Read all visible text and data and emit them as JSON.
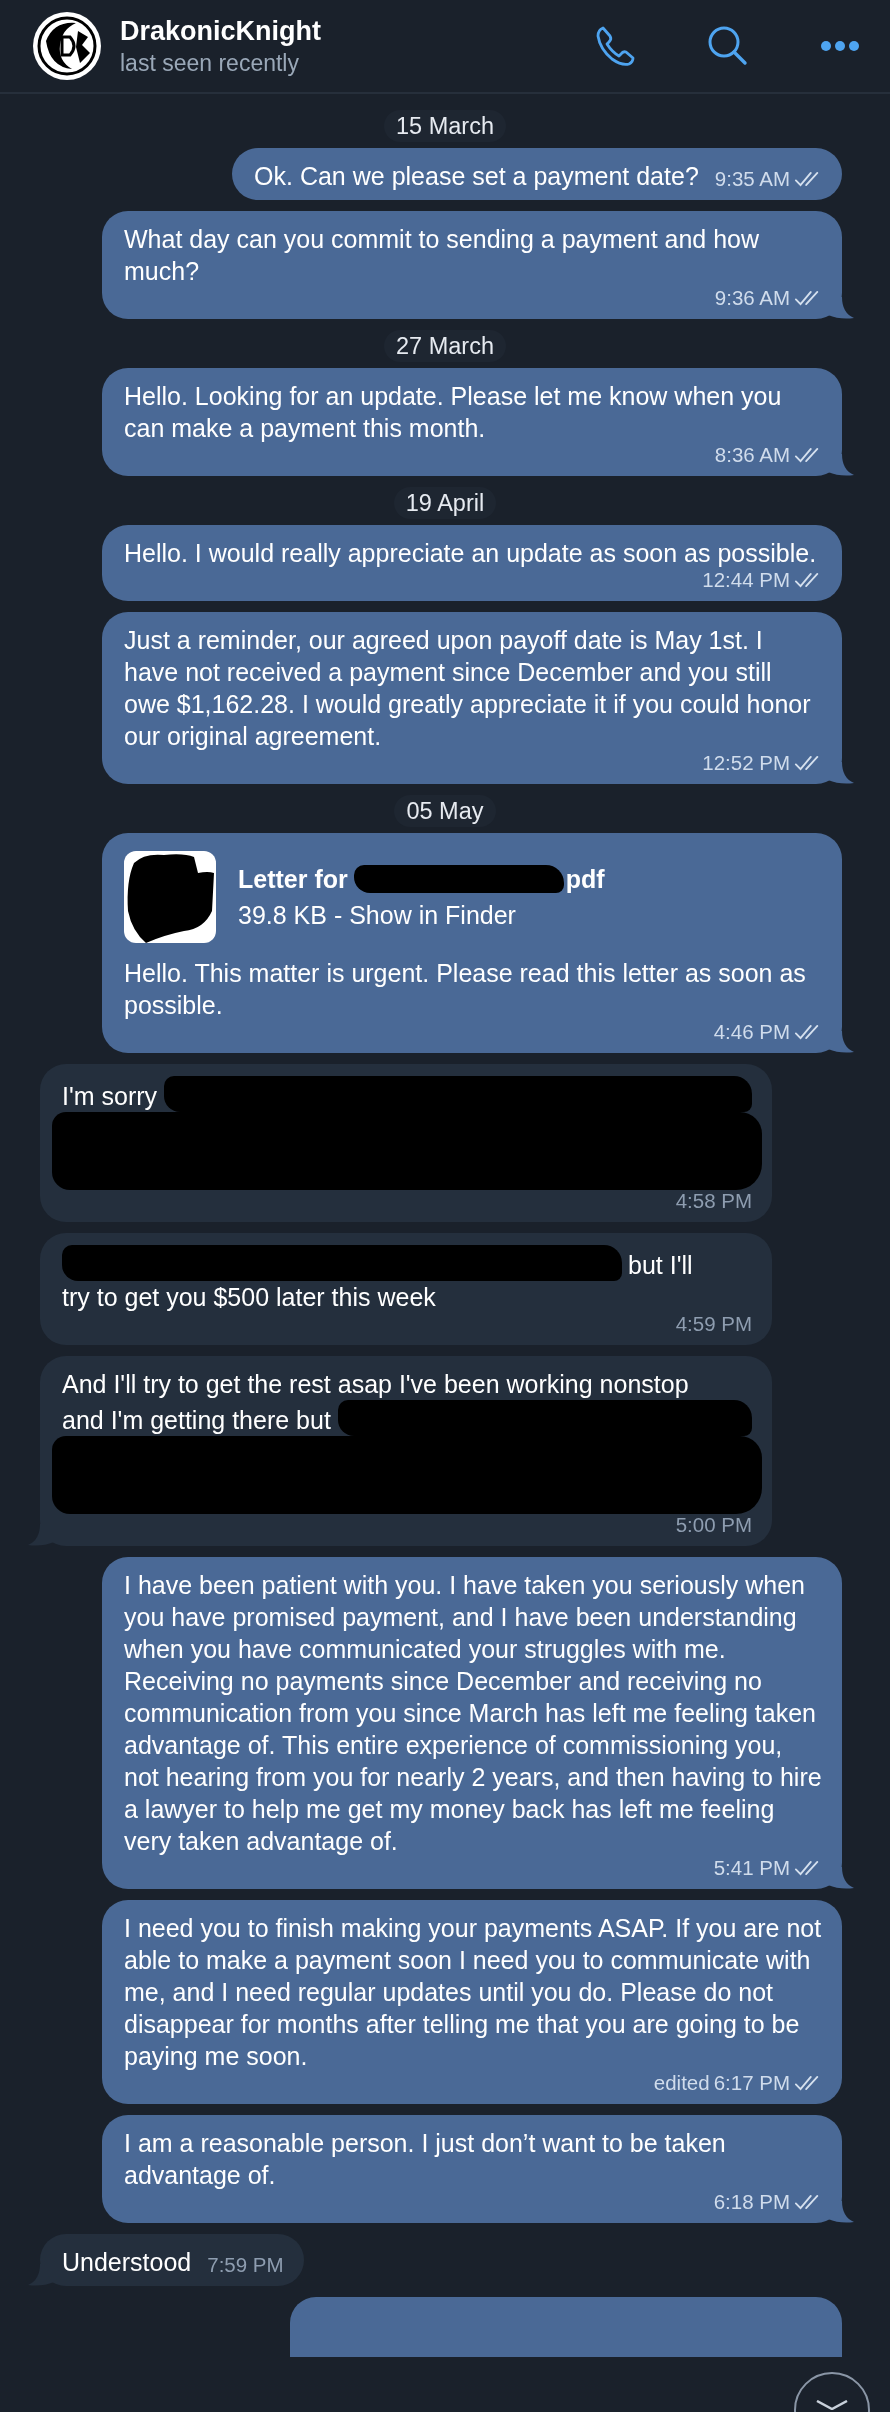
{
  "header": {
    "name": "DrakonicKnight",
    "status": "last seen recently"
  },
  "feed": [
    {
      "kind": "date",
      "text": "15 March"
    },
    {
      "kind": "message",
      "outgoing": true,
      "parts": [
        {
          "kind": "text",
          "text": "Ok. Can we please set a payment date?"
        }
      ],
      "time": "9:35 AM",
      "read": true,
      "tail": false
    },
    {
      "kind": "message",
      "outgoing": true,
      "parts": [
        {
          "kind": "text",
          "text": "What day can you commit to sending a payment and how much?"
        }
      ],
      "time": "9:36 AM",
      "read": true,
      "tail": true
    },
    {
      "kind": "date",
      "text": "27 March"
    },
    {
      "kind": "message",
      "outgoing": true,
      "parts": [
        {
          "kind": "text",
          "text": "Hello. Looking for an update. Please let me know when you can make a payment this month."
        }
      ],
      "time": "8:36 AM",
      "read": true,
      "tail": true
    },
    {
      "kind": "date",
      "text": "19 April"
    },
    {
      "kind": "message",
      "outgoing": true,
      "parts": [
        {
          "kind": "text",
          "text": "Hello. I would really appreciate an update as soon as possible."
        }
      ],
      "time": "12:44 PM",
      "read": true,
      "tail": false
    },
    {
      "kind": "message",
      "outgoing": true,
      "parts": [
        {
          "kind": "text",
          "text": "Just a reminder, our agreed upon payoff date is May 1st. I have not received a payment since December and you still owe $1,162.28. I would greatly appreciate it if you could honor our original agreement."
        }
      ],
      "time": "12:52 PM",
      "read": true,
      "tail": true
    },
    {
      "kind": "date",
      "text": "05 May"
    },
    {
      "kind": "message",
      "outgoing": true,
      "attachment": {
        "name_parts": [
          {
            "kind": "text",
            "text": "Letter for"
          },
          {
            "kind": "redaction_span"
          },
          {
            "kind": "text",
            "text": "pdf"
          }
        ],
        "details": "39.8 KB - Show in Finder"
      },
      "parts": [
        {
          "kind": "text",
          "text": "Hello. This matter is urgent. Please read this letter as soon as possible."
        }
      ],
      "time": "4:46 PM",
      "read": true,
      "tail": true
    },
    {
      "kind": "message",
      "outgoing": false,
      "parts": [
        {
          "kind": "line",
          "text": "I'm sorry"
        },
        {
          "kind": "redaction_fill"
        },
        {
          "kind": "redaction_block"
        }
      ],
      "time": "4:58 PM",
      "tail": false
    },
    {
      "kind": "message",
      "outgoing": false,
      "parts": [
        {
          "kind": "redaction_span"
        },
        {
          "kind": "line",
          "text": "but I'll"
        },
        {
          "kind": "line",
          "text": "try to get you $500 later this week"
        }
      ],
      "time": "4:59 PM",
      "tail": false
    },
    {
      "kind": "message",
      "outgoing": false,
      "parts": [
        {
          "kind": "line",
          "text": "And I'll try to get the rest asap I've been working nonstop"
        },
        {
          "kind": "line",
          "text": "and I'm getting there but"
        },
        {
          "kind": "redaction_fill"
        },
        {
          "kind": "redaction_block"
        }
      ],
      "time": "5:00 PM",
      "tail": true
    },
    {
      "kind": "message",
      "outgoing": true,
      "parts": [
        {
          "kind": "text",
          "text": "I have been patient with you. I have taken you seriously when you have promised payment, and I have been understanding when you have communicated your struggles with me. Receiving no payments since December and receiving no communication from you since March has left me feeling taken advantage of. This entire experience of commissioning you, not hearing from you for nearly 2 years, and then having to hire a lawyer to help me get my money back has left me feeling very taken advantage of."
        }
      ],
      "time": "5:41 PM",
      "read": true,
      "tail": true
    },
    {
      "kind": "message",
      "outgoing": true,
      "parts": [
        {
          "kind": "text",
          "text": "I need you to finish making your payments ASAP. If you are not able to make a payment soon I need you to communicate with me, and I need regular updates until you do. Please do not disappear for months after telling me that you are going to be paying me soon."
        }
      ],
      "edited": "edited",
      "time": "6:17 PM",
      "read": true,
      "tail": false
    },
    {
      "kind": "message",
      "outgoing": true,
      "parts": [
        {
          "kind": "text",
          "text": "I am a reasonable person. I just don’t want to be taken advantage of."
        }
      ],
      "time": "6:18 PM",
      "read": true,
      "tail": true
    },
    {
      "kind": "message",
      "outgoing": false,
      "parts": [
        {
          "kind": "text",
          "text": "Understood"
        }
      ],
      "time": "7:59 PM",
      "tail": true
    }
  ]
}
